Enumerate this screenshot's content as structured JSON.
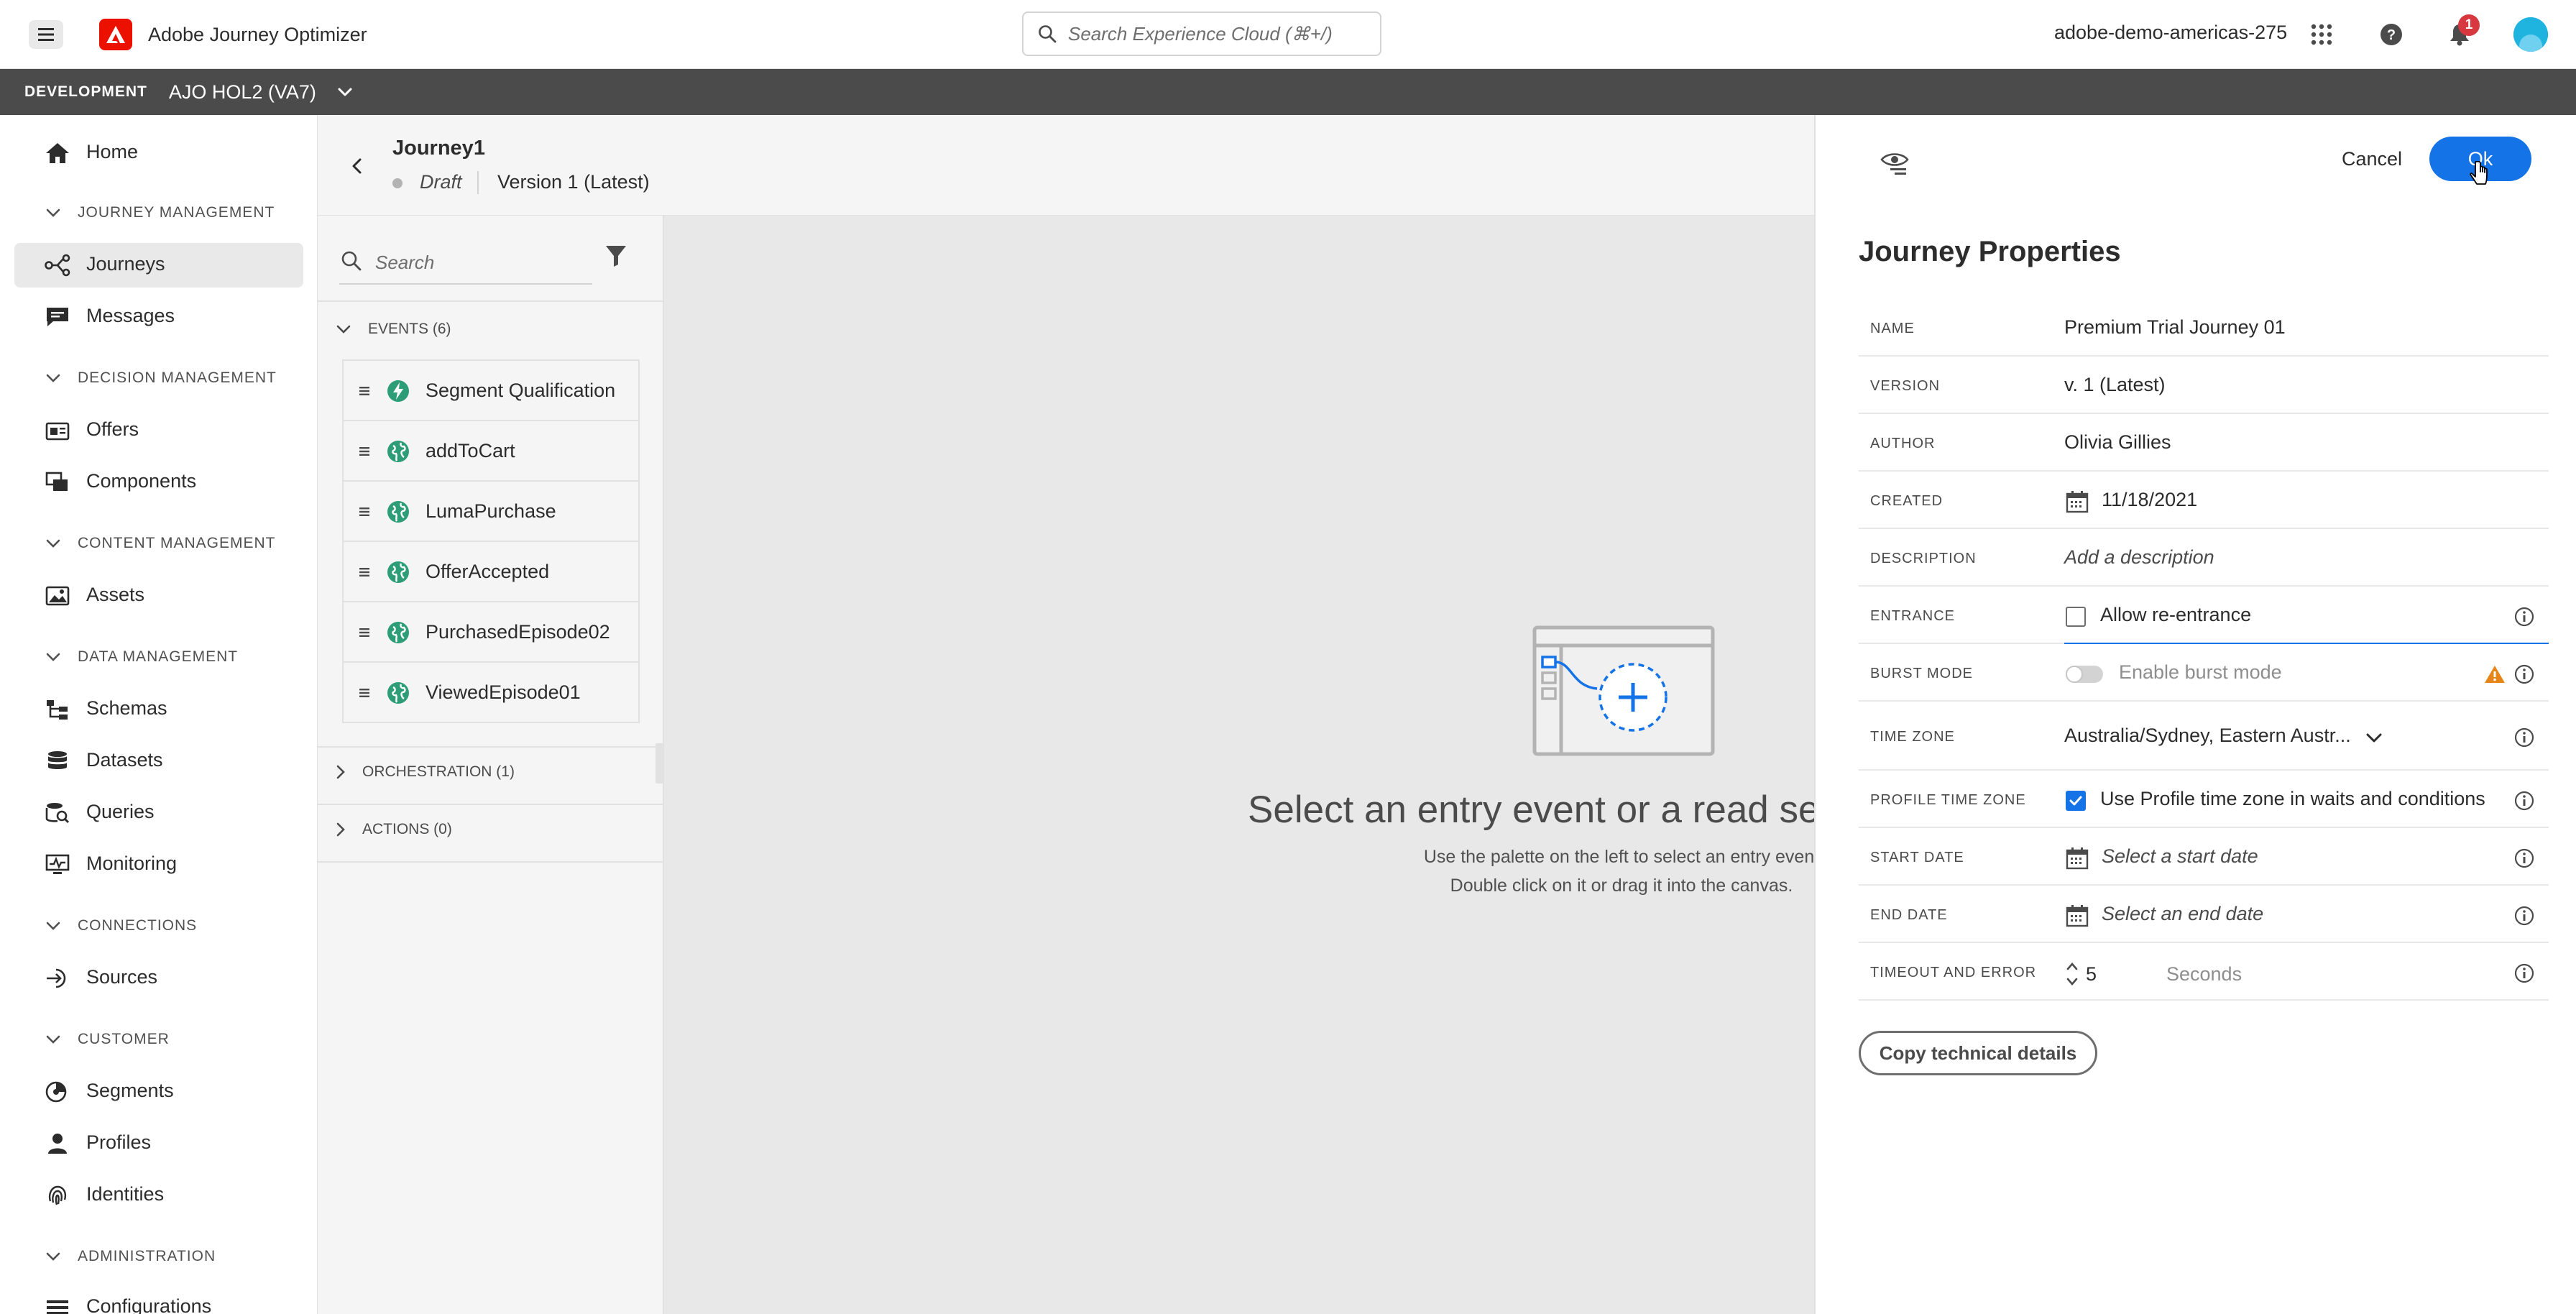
{
  "header": {
    "app_title": "Adobe Journey Optimizer",
    "search_placeholder": "Search Experience Cloud (⌘+/)",
    "org_name": "adobe-demo-americas-275",
    "notification_count": "1"
  },
  "sandbox": {
    "environment": "DEVELOPMENT",
    "name": "AJO HOL2 (VA7)"
  },
  "sidebar": {
    "home": "Home",
    "sections": {
      "journey_management": "JOURNEY MANAGEMENT",
      "decision_management": "DECISION MANAGEMENT",
      "content_management": "CONTENT MANAGEMENT",
      "data_management": "DATA MANAGEMENT",
      "connections": "CONNECTIONS",
      "customer": "CUSTOMER",
      "administration": "ADMINISTRATION"
    },
    "items": {
      "journeys": "Journeys",
      "messages": "Messages",
      "offers": "Offers",
      "components": "Components",
      "assets": "Assets",
      "schemas": "Schemas",
      "datasets": "Datasets",
      "queries": "Queries",
      "monitoring": "Monitoring",
      "sources": "Sources",
      "segments": "Segments",
      "profiles": "Profiles",
      "identities": "Identities",
      "configurations": "Configurations"
    }
  },
  "journey": {
    "title": "Journey1",
    "status": "Draft",
    "version": "Version 1 (Latest)"
  },
  "palette": {
    "search_placeholder": "Search",
    "events_header": "EVENTS (6)",
    "events": [
      {
        "label": "Segment Qualification",
        "icon": "lightning-icon"
      },
      {
        "label": "addToCart",
        "icon": "globe-icon"
      },
      {
        "label": "LumaPurchase",
        "icon": "globe-icon"
      },
      {
        "label": "OfferAccepted",
        "icon": "globe-icon"
      },
      {
        "label": "PurchasedEpisode02",
        "icon": "globe-icon"
      },
      {
        "label": "ViewedEpisode01",
        "icon": "globe-icon"
      }
    ],
    "orchestration_header": "ORCHESTRATION (1)",
    "actions_header": "ACTIONS (0)"
  },
  "canvas": {
    "heading": "Select an entry event or a read segm",
    "sub_line1": "Use the palette on the left to select an entry event",
    "sub_line2": "Double click on it or drag it into the canvas."
  },
  "properties": {
    "cancel_label": "Cancel",
    "ok_label": "Ok",
    "title": "Journey Properties",
    "rows": {
      "name": {
        "label": "NAME",
        "value": "Premium Trial Journey 01"
      },
      "version": {
        "label": "VERSION",
        "value": "v. 1 (Latest)"
      },
      "author": {
        "label": "AUTHOR",
        "value": "Olivia Gillies"
      },
      "created": {
        "label": "CREATED",
        "value": "11/18/2021"
      },
      "description": {
        "label": "DESCRIPTION",
        "placeholder": "Add a description"
      },
      "entrance": {
        "label": "ENTRANCE",
        "option": "Allow re-entrance",
        "checked": false
      },
      "burst_mode": {
        "label": "BURST MODE",
        "option": "Enable burst mode",
        "enabled": false
      },
      "time_zone": {
        "label": "TIME ZONE",
        "value": "Australia/Sydney, Eastern Austr..."
      },
      "profile_time_zone": {
        "label": "PROFILE TIME ZONE",
        "option": "Use Profile time zone in waits and conditions",
        "checked": true
      },
      "start_date": {
        "label": "START DATE",
        "placeholder": "Select a start date"
      },
      "end_date": {
        "label": "END DATE",
        "placeholder": "Select an end date"
      },
      "timeout": {
        "label": "TIMEOUT AND ERROR",
        "value": "5",
        "unit": "Seconds"
      }
    },
    "copy_button": "Copy technical details"
  },
  "colors": {
    "accent": "#1473e6",
    "brand": "#eb1000",
    "sandbox_bar": "#4b4b4b",
    "event_icon": "#2d9d78",
    "warning": "#e68619"
  }
}
